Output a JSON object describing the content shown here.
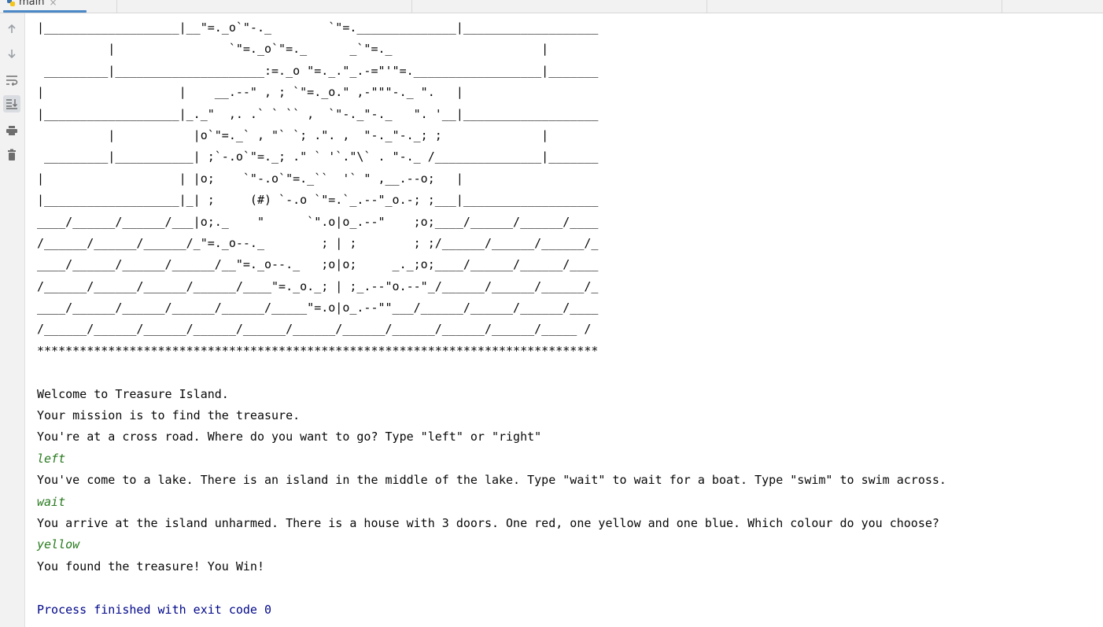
{
  "tab": {
    "label": "main"
  },
  "toolbar": [
    {
      "name": "up-arrow-icon"
    },
    {
      "name": "down-arrow-icon"
    },
    {
      "name": "soft-wrap-icon"
    },
    {
      "name": "scroll-to-end-icon"
    },
    {
      "name": "print-icon"
    },
    {
      "name": "trash-icon"
    }
  ],
  "art": [
    "|___________________|__\"=._o`\"-._        `\"=.______________|___________________",
    "          |                `\"=._o`\"=._      _`\"=._                     |",
    " _________|_____________________:=._o \"=._.\"_.-=\"'\"=.__________________|_______",
    "|                   |    __.--\" , ; `\"=._o.\" ,-\"\"\"-._ \".   |",
    "|___________________|_._\"  ,. .` ` `` ,  `\"-._\"-._   \". '__|___________________",
    "          |           |o`\"=._` , \"` `; .\". ,  \"-._\"-._; ;              |",
    " _________|___________| ;`-.o`\"=._; .\" ` '`.\"\\` . \"-._ /_______________|_______",
    "|                   | |o;    `\"-.o`\"=._``  '` \" ,__.--o;   |",
    "|___________________|_| ;     (#) `-.o `\"=.`_.--\"_o.-; ;___|___________________",
    "____/______/______/___|o;._    \"      `\".o|o_.--\"    ;o;____/______/______/____",
    "/______/______/______/_\"=._o--._        ; | ;        ; ;/______/______/______/_",
    "____/______/______/______/__\"=._o--._   ;o|o;     _._;o;____/______/______/____",
    "/______/______/______/______/____\"=._o._; | ;_.--\"o.--\"_/______/______/______/_",
    "____/______/______/______/______/_____\"=.o|o_.--\"\"___/______/______/______/____",
    "/______/______/______/______/______/______/______/______/______/______/_____ /",
    "*******************************************************************************"
  ],
  "output": [
    {
      "kind": "blank",
      "text": ""
    },
    {
      "kind": "stdout",
      "text": "Welcome to Treasure Island."
    },
    {
      "kind": "stdout",
      "text": "Your mission is to find the treasure."
    },
    {
      "kind": "stdout",
      "text": "You're at a cross road. Where do you want to go? Type \"left\" or \"right\""
    },
    {
      "kind": "input",
      "text": "left"
    },
    {
      "kind": "stdout",
      "text": "You've come to a lake. There is an island in the middle of the lake. Type \"wait\" to wait for a boat. Type \"swim\" to swim across."
    },
    {
      "kind": "input",
      "text": "wait"
    },
    {
      "kind": "stdout",
      "text": "You arrive at the island unharmed. There is a house with 3 doors. One red, one yellow and one blue. Which colour do you choose?"
    },
    {
      "kind": "input",
      "text": "yellow"
    },
    {
      "kind": "stdout",
      "text": "You found the treasure! You Win!"
    },
    {
      "kind": "blank",
      "text": ""
    },
    {
      "kind": "process",
      "text": "Process finished with exit code 0"
    }
  ],
  "colors": {
    "input": "#287a1e",
    "process": "#00078a",
    "stdout": "#080808",
    "accent": "#4a88c7"
  }
}
